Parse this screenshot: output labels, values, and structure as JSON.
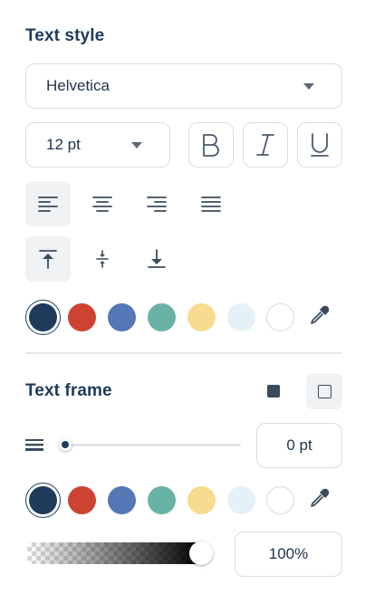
{
  "text_style": {
    "title": "Text style",
    "font_select": {
      "value": "Helvetica"
    },
    "size_select": {
      "value": "12 pt"
    },
    "format_buttons": [
      {
        "name": "bold",
        "label": "B"
      },
      {
        "name": "italic",
        "label": "I"
      },
      {
        "name": "underline",
        "label": "U"
      }
    ],
    "align_horizontal": [
      "align-left-icon",
      "align-center-icon",
      "align-right-icon",
      "align-justify-icon"
    ],
    "align_vertical": [
      "align-top-icon",
      "align-middle-icon",
      "align-bottom-icon"
    ],
    "colors": [
      "#1e3b5c",
      "#cc4331",
      "#5478b6",
      "#69b2a6",
      "#f7dc8f",
      "#e4f1f7",
      "#ffffff"
    ],
    "selected_color": "#1e3b5c"
  },
  "text_frame": {
    "title": "Text frame",
    "shape_toggle": [
      "filled-square-icon",
      "outline-square-icon"
    ],
    "border_width": {
      "value_text": "0 pt",
      "fraction": 0.0,
      "icon": "line-weight-icon"
    },
    "colors": [
      "#1e3b5c",
      "#cc4331",
      "#5478b6",
      "#69b2a6",
      "#f7dc8f",
      "#e4f1f7",
      "#ffffff"
    ],
    "selected_color": "#1e3b5c",
    "opacity": {
      "value_text": "100%",
      "fraction": 1.0
    }
  },
  "icons": {
    "eyedropper": "eyedropper-icon"
  }
}
